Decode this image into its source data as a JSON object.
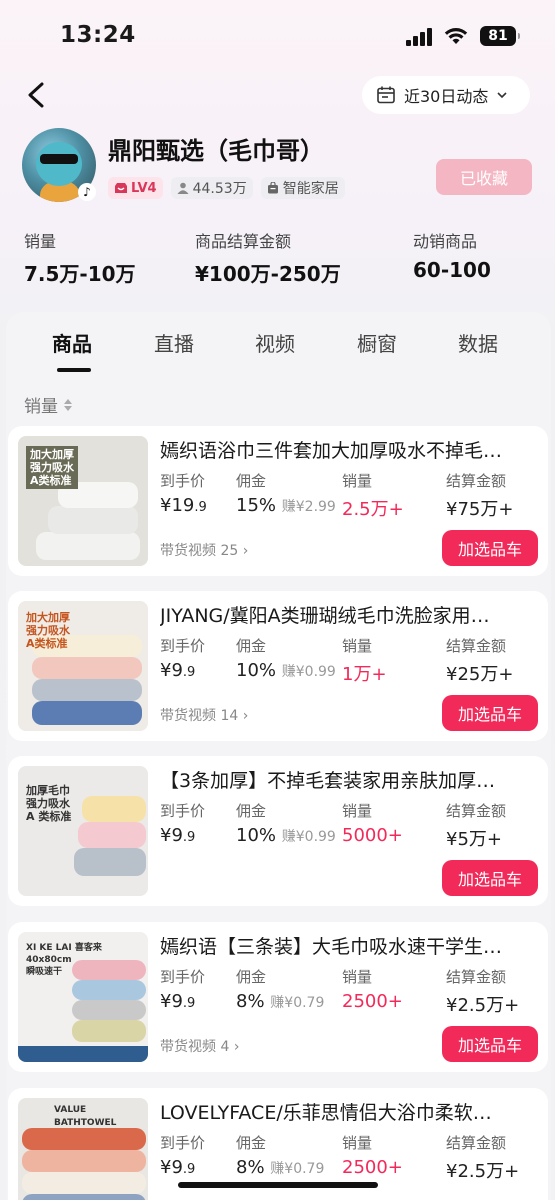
{
  "status": {
    "time": "13:24",
    "battery": "81"
  },
  "header": {
    "period": "近30日动态"
  },
  "shop": {
    "name": "鼎阳甄选（毛巾哥）",
    "level": "LV4",
    "fans": "44.53万",
    "category": "智能家居",
    "collected_label": "已收藏"
  },
  "stats": [
    {
      "label": "销量",
      "value": "7.5万-10万"
    },
    {
      "label": "商品结算金额",
      "value": "¥100万-250万"
    },
    {
      "label": "动销商品",
      "value": "60-100"
    }
  ],
  "tabs": [
    "商品",
    "直播",
    "视频",
    "橱窗",
    "数据"
  ],
  "sort_label": "销量",
  "columns": {
    "price": "到手价",
    "commission": "佣金",
    "sales": "销量",
    "amount": "结算金额"
  },
  "add_label": "加选品车",
  "products": [
    {
      "title": "嫣织语浴巾三件套加大加厚吸水不掉毛…",
      "price_int": "¥19",
      "price_dec": ".9",
      "rate": "15%",
      "earn": "赚¥2.99",
      "sales": "2.5万+",
      "amount": "¥75万+",
      "videos": "带货视频 25",
      "thumb_text": "加大加厚\n强力吸水\nA类标准"
    },
    {
      "title": "JIYANG/冀阳A类珊瑚绒毛巾洗脸家用…",
      "price_int": "¥9",
      "price_dec": ".9",
      "rate": "10%",
      "earn": "赚¥0.99",
      "sales": "1万+",
      "amount": "¥25万+",
      "videos": "带货视频 14",
      "thumb_text": "加大加厚\n强力吸水\nA类标准"
    },
    {
      "title": "【3条加厚】不掉毛套装家用亲肤加厚…",
      "price_int": "¥9",
      "price_dec": ".9",
      "rate": "10%",
      "earn": "赚¥0.99",
      "sales": "5000+",
      "amount": "¥5万+",
      "videos": "",
      "thumb_text": "加厚毛巾\n强力吸水\nA 类标准"
    },
    {
      "title": "嫣织语【三条装】大毛巾吸水速干学生…",
      "price_int": "¥9",
      "price_dec": ".9",
      "rate": "8%",
      "earn": "赚¥0.79",
      "sales": "2500+",
      "amount": "¥2.5万+",
      "videos": "带货视频 4",
      "thumb_text": "XI KE LAI 喜客来\n40x80cm\n瞬吸速干"
    },
    {
      "title": "LOVELYFACE/乐菲思情侣大浴巾柔软…",
      "price_int": "¥9",
      "price_dec": ".9",
      "rate": "8%",
      "earn": "赚¥0.79",
      "sales": "2500+",
      "amount": "¥2.5万+",
      "videos": "",
      "thumb_text": "VALUE BATHTOWEL"
    }
  ]
}
